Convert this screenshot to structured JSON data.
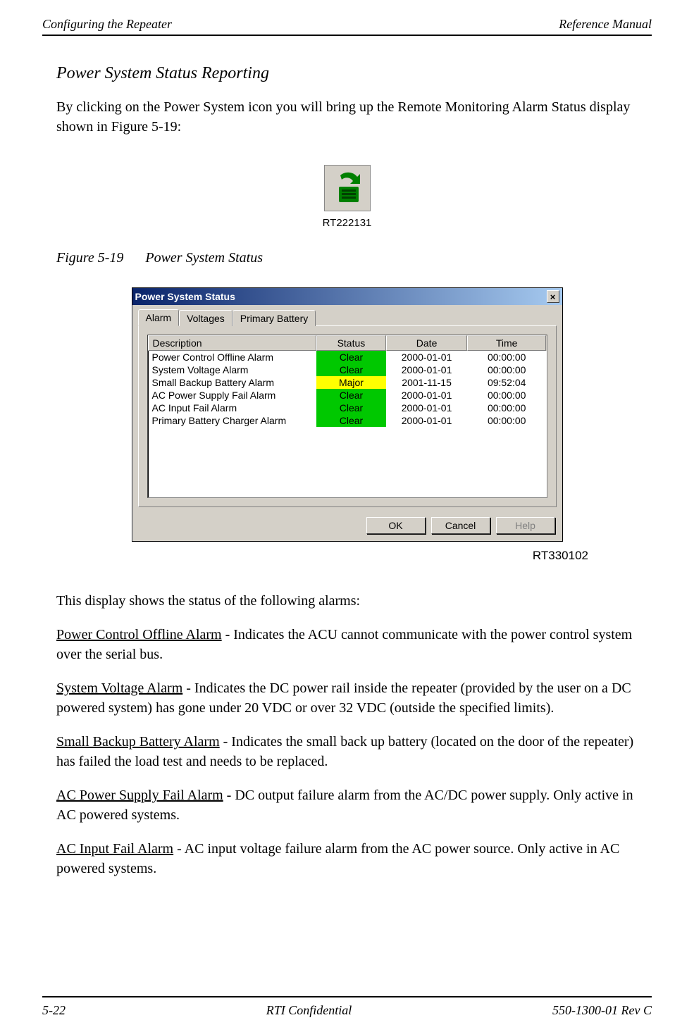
{
  "header": {
    "left": "Configuring the Repeater",
    "right": "Reference Manual"
  },
  "section_title": "Power System Status Reporting",
  "intro_text": "By clicking on the Power System icon you will bring up the Remote Monitoring Alarm Status display shown in Figure 5-19:",
  "icon_rt": "RT222131",
  "figure": {
    "number": "Figure 5-19",
    "title": "Power System Status"
  },
  "window": {
    "title": "Power System Status",
    "close_label": "×",
    "tabs": [
      "Alarm",
      "Voltages",
      "Primary Battery"
    ],
    "active_tab": 0,
    "columns": {
      "description": "Description",
      "status": "Status",
      "date": "Date",
      "time": "Time"
    },
    "rows": [
      {
        "description": "Power Control Offline Alarm",
        "status": "Clear",
        "status_class": "clear",
        "date": "2000-01-01",
        "time": "00:00:00"
      },
      {
        "description": "System Voltage Alarm",
        "status": "Clear",
        "status_class": "clear",
        "date": "2000-01-01",
        "time": "00:00:00"
      },
      {
        "description": "Small Backup Battery Alarm",
        "status": "Major",
        "status_class": "major",
        "date": "2001-11-15",
        "time": "09:52:04"
      },
      {
        "description": "AC Power Supply Fail Alarm",
        "status": "Clear",
        "status_class": "clear",
        "date": "2000-01-01",
        "time": "00:00:00"
      },
      {
        "description": "AC Input Fail Alarm",
        "status": "Clear",
        "status_class": "clear",
        "date": "2000-01-01",
        "time": "00:00:00"
      },
      {
        "description": "Primary Battery Charger Alarm",
        "status": "Clear",
        "status_class": "clear",
        "date": "2000-01-01",
        "time": "00:00:00"
      }
    ],
    "buttons": {
      "ok": "OK",
      "cancel": "Cancel",
      "help": "Help"
    }
  },
  "screenshot_rt": "RT330102",
  "after_text": "This display shows the status of the following alarms:",
  "alarms": [
    {
      "name": "Power Control Offline Alarm",
      "desc": " - Indicates the ACU cannot communicate with the power control system over the serial bus."
    },
    {
      "name": "System Voltage Alarm",
      "desc": " - Indicates the DC power rail inside the repeater (provided by the user on a DC powered system) has gone under 20 VDC or over 32 VDC (outside the specified limits)."
    },
    {
      "name": "Small Backup Battery Alarm",
      "desc": " - Indicates the small back up battery (located on the door of the repeater) has failed the load test and needs to be replaced."
    },
    {
      "name": "AC Power Supply Fail Alarm",
      "desc": " - DC output failure alarm from the AC/DC power supply. Only active in AC powered systems."
    },
    {
      "name": "AC Input Fail Alarm",
      "desc": " - AC input voltage failure alarm from the AC power source. Only active in AC powered systems."
    }
  ],
  "footer": {
    "left": "5-22",
    "center": "RTI Confidential",
    "right": "550-1300-01 Rev C"
  }
}
